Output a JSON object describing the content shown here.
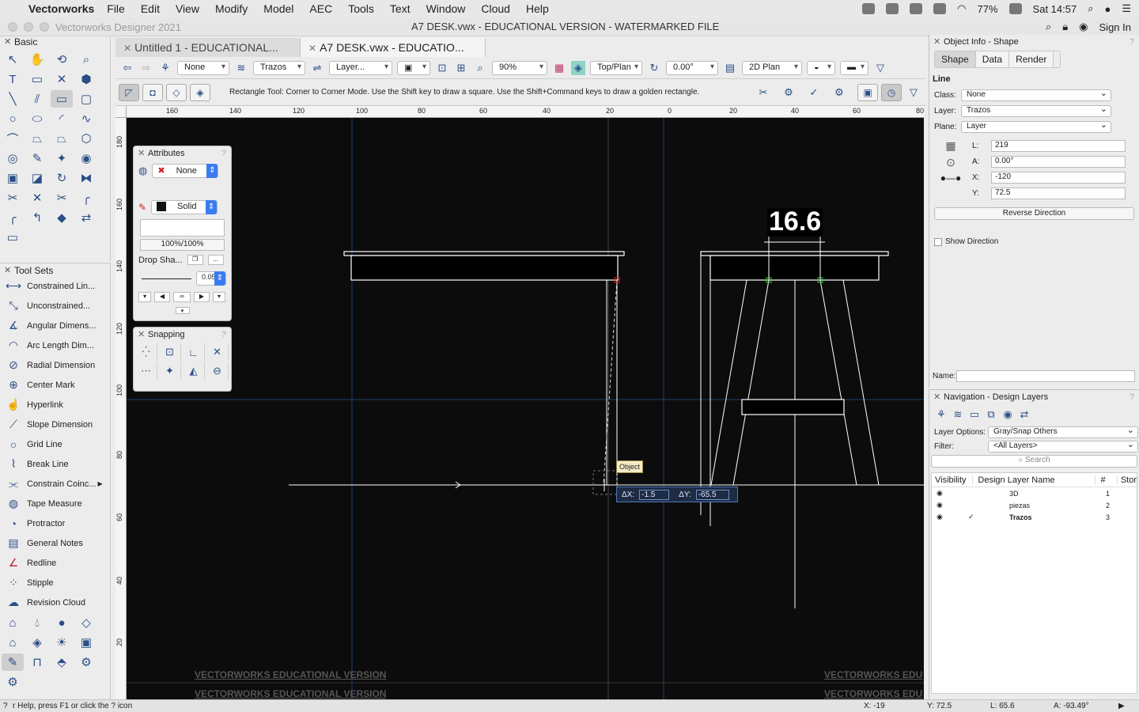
{
  "menubar": {
    "app_name": "Vectorworks",
    "items": [
      "File",
      "Edit",
      "View",
      "Modify",
      "Model",
      "AEC",
      "Tools",
      "Text",
      "Window",
      "Cloud",
      "Help"
    ],
    "battery": "77%",
    "clock": "Sat 14:57"
  },
  "window": {
    "app_title": "Vectorworks Designer 2021",
    "doc_title": "A7 DESK.vwx - EDUCATIONAL VERSION - WATERMARKED FILE",
    "sign_in": "Sign In"
  },
  "tabs": [
    {
      "label": "Untitled 1 - EDUCATIONAL..."
    },
    {
      "label": "A7 DESK.vwx - EDUCATIO..."
    }
  ],
  "viewbar": {
    "class": "None",
    "layer": "Trazos",
    "layer2": "Layer...",
    "zoom": "90%",
    "view": "Top/Plan",
    "rotation": "0.00°",
    "render": "2D Plan"
  },
  "modebar": {
    "help": "Rectangle Tool: Corner to Corner Mode. Use the Shift key to draw a square. Use the Shift+Command keys to draw a golden rectangle."
  },
  "basic_palette": {
    "title": "Basic"
  },
  "toolsets": {
    "title": "Tool Sets",
    "items": [
      "Constrained Lin...",
      "Unconstrained...",
      "Angular Dimens...",
      "Arc Length Dim...",
      "Radial Dimension",
      "Center Mark",
      "Hyperlink",
      "Slope Dimension",
      "Grid Line",
      "Break Line",
      "Constrain Coinc...",
      "Tape Measure",
      "Protractor",
      "General Notes",
      "Redline",
      "Stipple",
      "Revision Cloud"
    ]
  },
  "attributes": {
    "title": "Attributes",
    "fill": "None",
    "pen": "Solid",
    "opacity": "100%/100%",
    "drop_shadow": "Drop Sha...",
    "line_weight": "0.05"
  },
  "snapping": {
    "title": "Snapping"
  },
  "hruler_ticks": [
    "160",
    "140",
    "120",
    "100",
    "80",
    "60",
    "40",
    "20",
    "0",
    "20",
    "40",
    "60",
    "80"
  ],
  "vruler_ticks": [
    "180",
    "160",
    "140",
    "120",
    "100",
    "80",
    "60",
    "40",
    "20"
  ],
  "canvas": {
    "dimension": "16.6",
    "snap_label": "Object",
    "dx_label": "ΔX:",
    "dx_value": "-1.5",
    "dy_label": "ΔY:",
    "dy_value": "-65.5",
    "watermark": "VECTORWORKS EDUCATIONAL VERSION",
    "watermark_cut": "VECTORWORKS EDU"
  },
  "object_info": {
    "title": "Object Info - Shape",
    "tabs": [
      "Shape",
      "Data",
      "Render"
    ],
    "object_type": "Line",
    "class_label": "Class:",
    "class": "None",
    "layer_label": "Layer:",
    "layer": "Trazos",
    "plane_label": "Plane:",
    "plane": "Layer",
    "l_label": "L:",
    "l_value": "219",
    "a_label": "A:",
    "a_value": "0.00°",
    "x_label": "X:",
    "x_value": "-120",
    "y_label": "Y:",
    "y_value": "72.5",
    "reverse": "Reverse Direction",
    "show_direction": "Show Direction",
    "name_label": "Name:"
  },
  "navigation": {
    "title": "Navigation - Design Layers",
    "layer_options_label": "Layer Options:",
    "layer_options": "Gray/Snap Others",
    "filter_label": "Filter:",
    "filter": "<All Layers>",
    "search_placeholder": "Search",
    "col_visibility": "Visibility",
    "col_name": "Design Layer Name",
    "col_num": "#",
    "col_stor": "Stor",
    "layers": [
      {
        "name": "3D",
        "num": "1"
      },
      {
        "name": "piezas",
        "num": "2"
      },
      {
        "name": "Trazos",
        "num": "3"
      }
    ]
  },
  "statusbar": {
    "help": "r Help, press F1 or click the ? icon",
    "x": "X: -19",
    "y": "Y: 72.5",
    "l": "L: 65.6",
    "a": "A: -93.49°"
  }
}
